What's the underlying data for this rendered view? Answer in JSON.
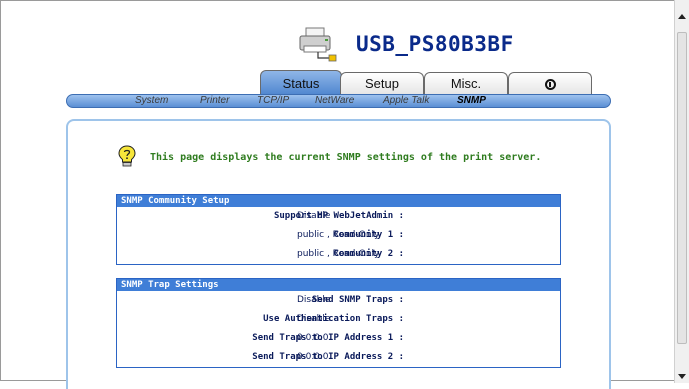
{
  "header": {
    "device_name": "USB_PS80B3BF",
    "printer_icon": "printer-icon"
  },
  "tabs": [
    {
      "label": "Status"
    },
    {
      "label": "Setup"
    },
    {
      "label": "Misc."
    },
    {
      "label": "",
      "icon": "power-icon"
    }
  ],
  "subnav": [
    {
      "label": "System"
    },
    {
      "label": "Printer"
    },
    {
      "label": "TCP/IP"
    },
    {
      "label": "NetWare"
    },
    {
      "label": "Apple Talk"
    },
    {
      "label": "SNMP"
    }
  ],
  "intro": {
    "icon": "lightbulb-help-icon",
    "text": "This page displays the current SNMP settings of the print server."
  },
  "community": {
    "title": "SNMP Community Setup",
    "rows": [
      {
        "label": "Support HP WebJetAdmin :",
        "value": "Disable"
      },
      {
        "label": "Community 1 :",
        "value": "public , Read-Only"
      },
      {
        "label": "Community 2 :",
        "value": "public , Read-Only"
      }
    ]
  },
  "traps": {
    "title": "SNMP Trap Settings",
    "rows": [
      {
        "label": "Send SNMP Traps :",
        "value": "Disable"
      },
      {
        "label": "Use Authentication Traps :",
        "value": "Disable"
      },
      {
        "label": "Send Traps to IP Address 1 :",
        "value": "0.0.0.0"
      },
      {
        "label": "Send Traps to IP Address 2 :",
        "value": "0.0.0.0"
      }
    ]
  },
  "colors": {
    "accent": "#3f7ed7",
    "title": "#0a2a8a",
    "intro_text": "#2f7c1f"
  }
}
